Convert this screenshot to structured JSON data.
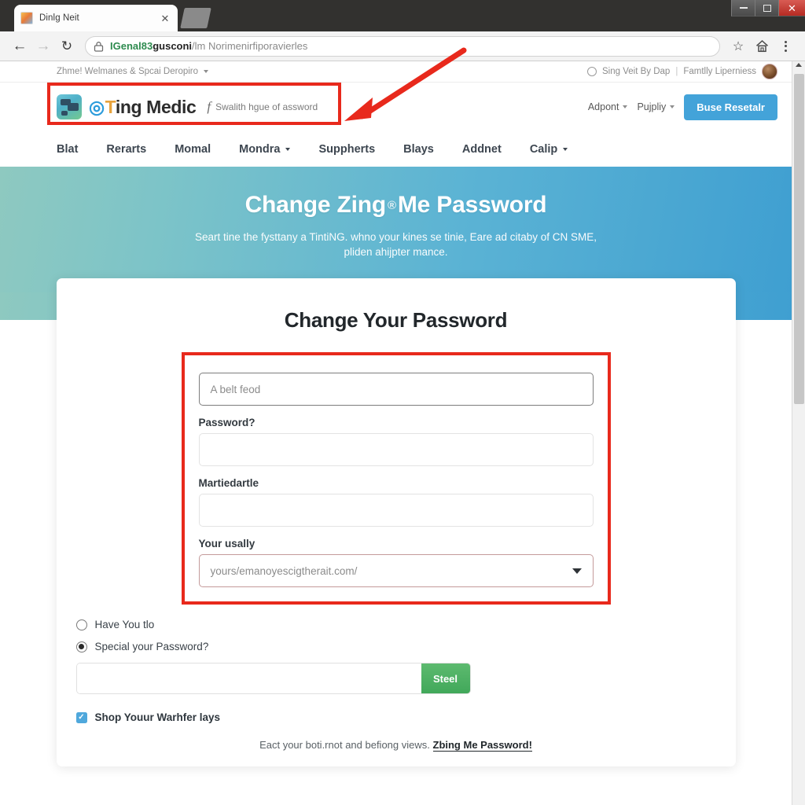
{
  "browser": {
    "tab_title": "Dinlg Neit",
    "tab_close_glyph": "✕",
    "back_glyph": "←",
    "forward_glyph": "→",
    "reload_glyph": "↻",
    "url_secure": "IGenal83",
    "url_host": "gusconi",
    "url_path": "/lm Norimenirfiporavierles",
    "star_glyph": "☆",
    "home_glyph": "⌂",
    "minimize_label": "–",
    "maximize_label": "□",
    "close_label": "✕"
  },
  "utility_bar": {
    "left_label": "Zhme! Welmanes & Spcai Deropiro",
    "right_label_1": "Sing Veit By Dap",
    "separator": "|",
    "right_label_2": "Famtlly Liperniess"
  },
  "brand": {
    "logo_at": "◎",
    "logo_t": "T",
    "logo_rest": "ing Medic",
    "tagline_f": "f",
    "tagline": "Swalith hgue of assword",
    "right_links": [
      {
        "label": "Adpont"
      },
      {
        "label": "Pujpliy"
      }
    ],
    "cta_label": "Buse Resetalr"
  },
  "mainnav": {
    "items": [
      {
        "label": "Blat",
        "caret": false
      },
      {
        "label": "Rerarts",
        "caret": false
      },
      {
        "label": "Momal",
        "caret": false
      },
      {
        "label": "Mondra",
        "caret": true
      },
      {
        "label": "Suppherts",
        "caret": false
      },
      {
        "label": "Blays",
        "caret": false
      },
      {
        "label": "Addnet",
        "caret": false
      },
      {
        "label": "Calip",
        "caret": true
      }
    ]
  },
  "hero": {
    "title_part1": "Change Zing",
    "title_reg": "®",
    "title_part2": "Me Password",
    "subtitle": "Seart tine the fysttany a TintiNG. whno your kines se tinie, Eare ad citaby of CN SME, pliden ahijpter mance."
  },
  "form": {
    "heading": "Change Your Password",
    "field_current": {
      "label": "",
      "placeholder": "A belt feod",
      "value": ""
    },
    "field_password": {
      "label": "Password?",
      "placeholder": "",
      "value": ""
    },
    "field_marked": {
      "label": "Martiedartle",
      "placeholder": "",
      "value": ""
    },
    "field_select": {
      "label": "Your usally",
      "value": "yours/emanoyescigtherait.com/"
    },
    "radios": [
      {
        "label": "Have You tlo",
        "selected": false
      },
      {
        "label": "Special your Password?",
        "selected": true
      }
    ],
    "inline": {
      "value": "",
      "button_label": "Steel"
    },
    "checkbox": {
      "label": "Shop Youur Warhfer lays",
      "checked": true,
      "glyph": "✓"
    },
    "footnote_text": "Eact your boti.rnot and befiong views.",
    "footnote_link": "Zbing Me Password!"
  },
  "colors": {
    "annotation_red": "#e8291c",
    "hero_left": "#8ec9c0",
    "hero_right": "#3f9fd1",
    "cta_blue": "#43a3d9",
    "submit_green": "#41a85a",
    "checkbox_blue": "#4fa8dc"
  }
}
